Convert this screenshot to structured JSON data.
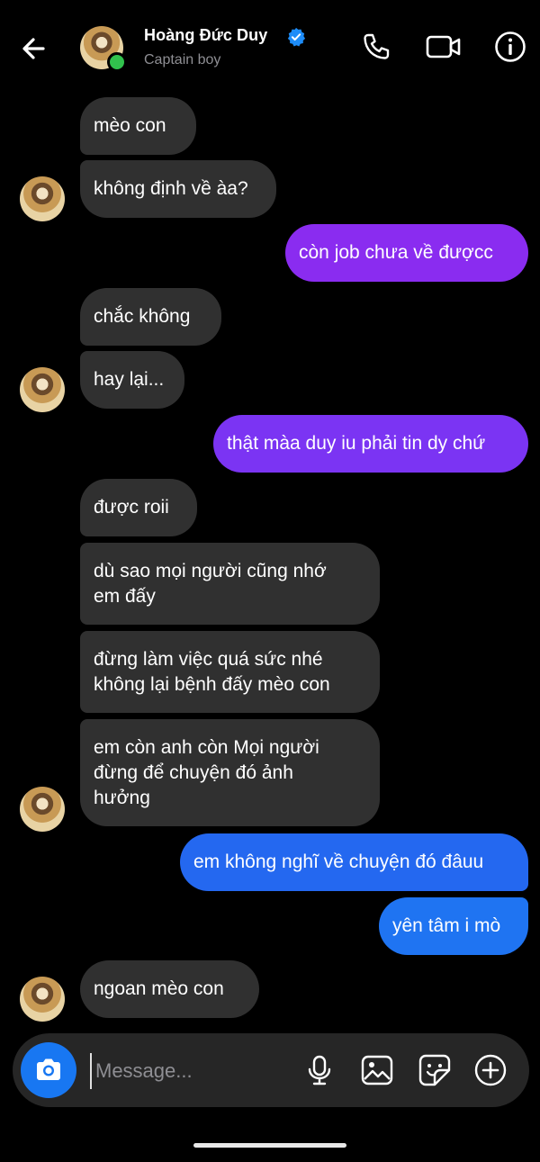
{
  "header": {
    "name": "Hoàng Đức Duy",
    "status": "Captain boy"
  },
  "messages": [
    {
      "text": "mèo con",
      "dir": "in"
    },
    {
      "text": "không định về àa?",
      "dir": "in"
    },
    {
      "text": "còn job chưa về đượcc",
      "dir": "out"
    },
    {
      "text": "chắc không",
      "dir": "in"
    },
    {
      "text": "hay lại...",
      "dir": "in"
    },
    {
      "text": "thật màa duy iu phải tin dy chứ",
      "dir": "out"
    },
    {
      "text": "được roii",
      "dir": "in"
    },
    {
      "text": "dù sao mọi người cũng nhớ\nem đấy",
      "dir": "in"
    },
    {
      "text": "đừng làm việc quá sức nhé\nkhông lại bệnh đấy mèo con",
      "dir": "in"
    },
    {
      "text": "em còn anh còn Mọi người\nđừng để chuyện đó ảnh\nhưởng",
      "dir": "in"
    },
    {
      "text": "em không nghĩ về chuyện đó đâuu",
      "dir": "out"
    },
    {
      "text": "yên tâm i mò",
      "dir": "out"
    },
    {
      "text": "ngoan mèo con",
      "dir": "in"
    }
  ],
  "composer": {
    "placeholder": "Message..."
  },
  "colors": {
    "incoming_bubble": "#303030",
    "outgoing_purple": "#8a2cf0",
    "outgoing_blue": "#1f74f2",
    "accent_blue": "#1877f2",
    "online_green": "#31c24d"
  }
}
